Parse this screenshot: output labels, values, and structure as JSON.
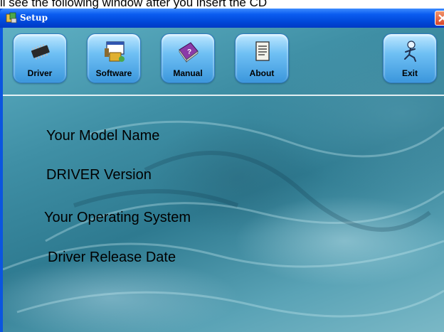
{
  "caption": "ll see the following window after you insert the CD",
  "window": {
    "title": "Setup",
    "close_icon": "close-icon"
  },
  "toolbar": {
    "buttons": [
      {
        "label": "Driver",
        "icon": "chip-icon"
      },
      {
        "label": "Software",
        "icon": "software-icon"
      },
      {
        "label": "Manual",
        "icon": "book-icon"
      },
      {
        "label": "About",
        "icon": "notepad-icon"
      },
      {
        "label": "Exit",
        "icon": "running-man-icon"
      }
    ]
  },
  "info": {
    "model_name": "Your Model Name",
    "driver_version": "DRIVER Version",
    "operating_system": "Your Operating System",
    "release_date": "Driver Release Date"
  },
  "colors": {
    "titlebar": "#0a5cf0",
    "button_top": "#bfe8ff",
    "button_bottom": "#3b96dc",
    "close_button": "#d8462a"
  }
}
